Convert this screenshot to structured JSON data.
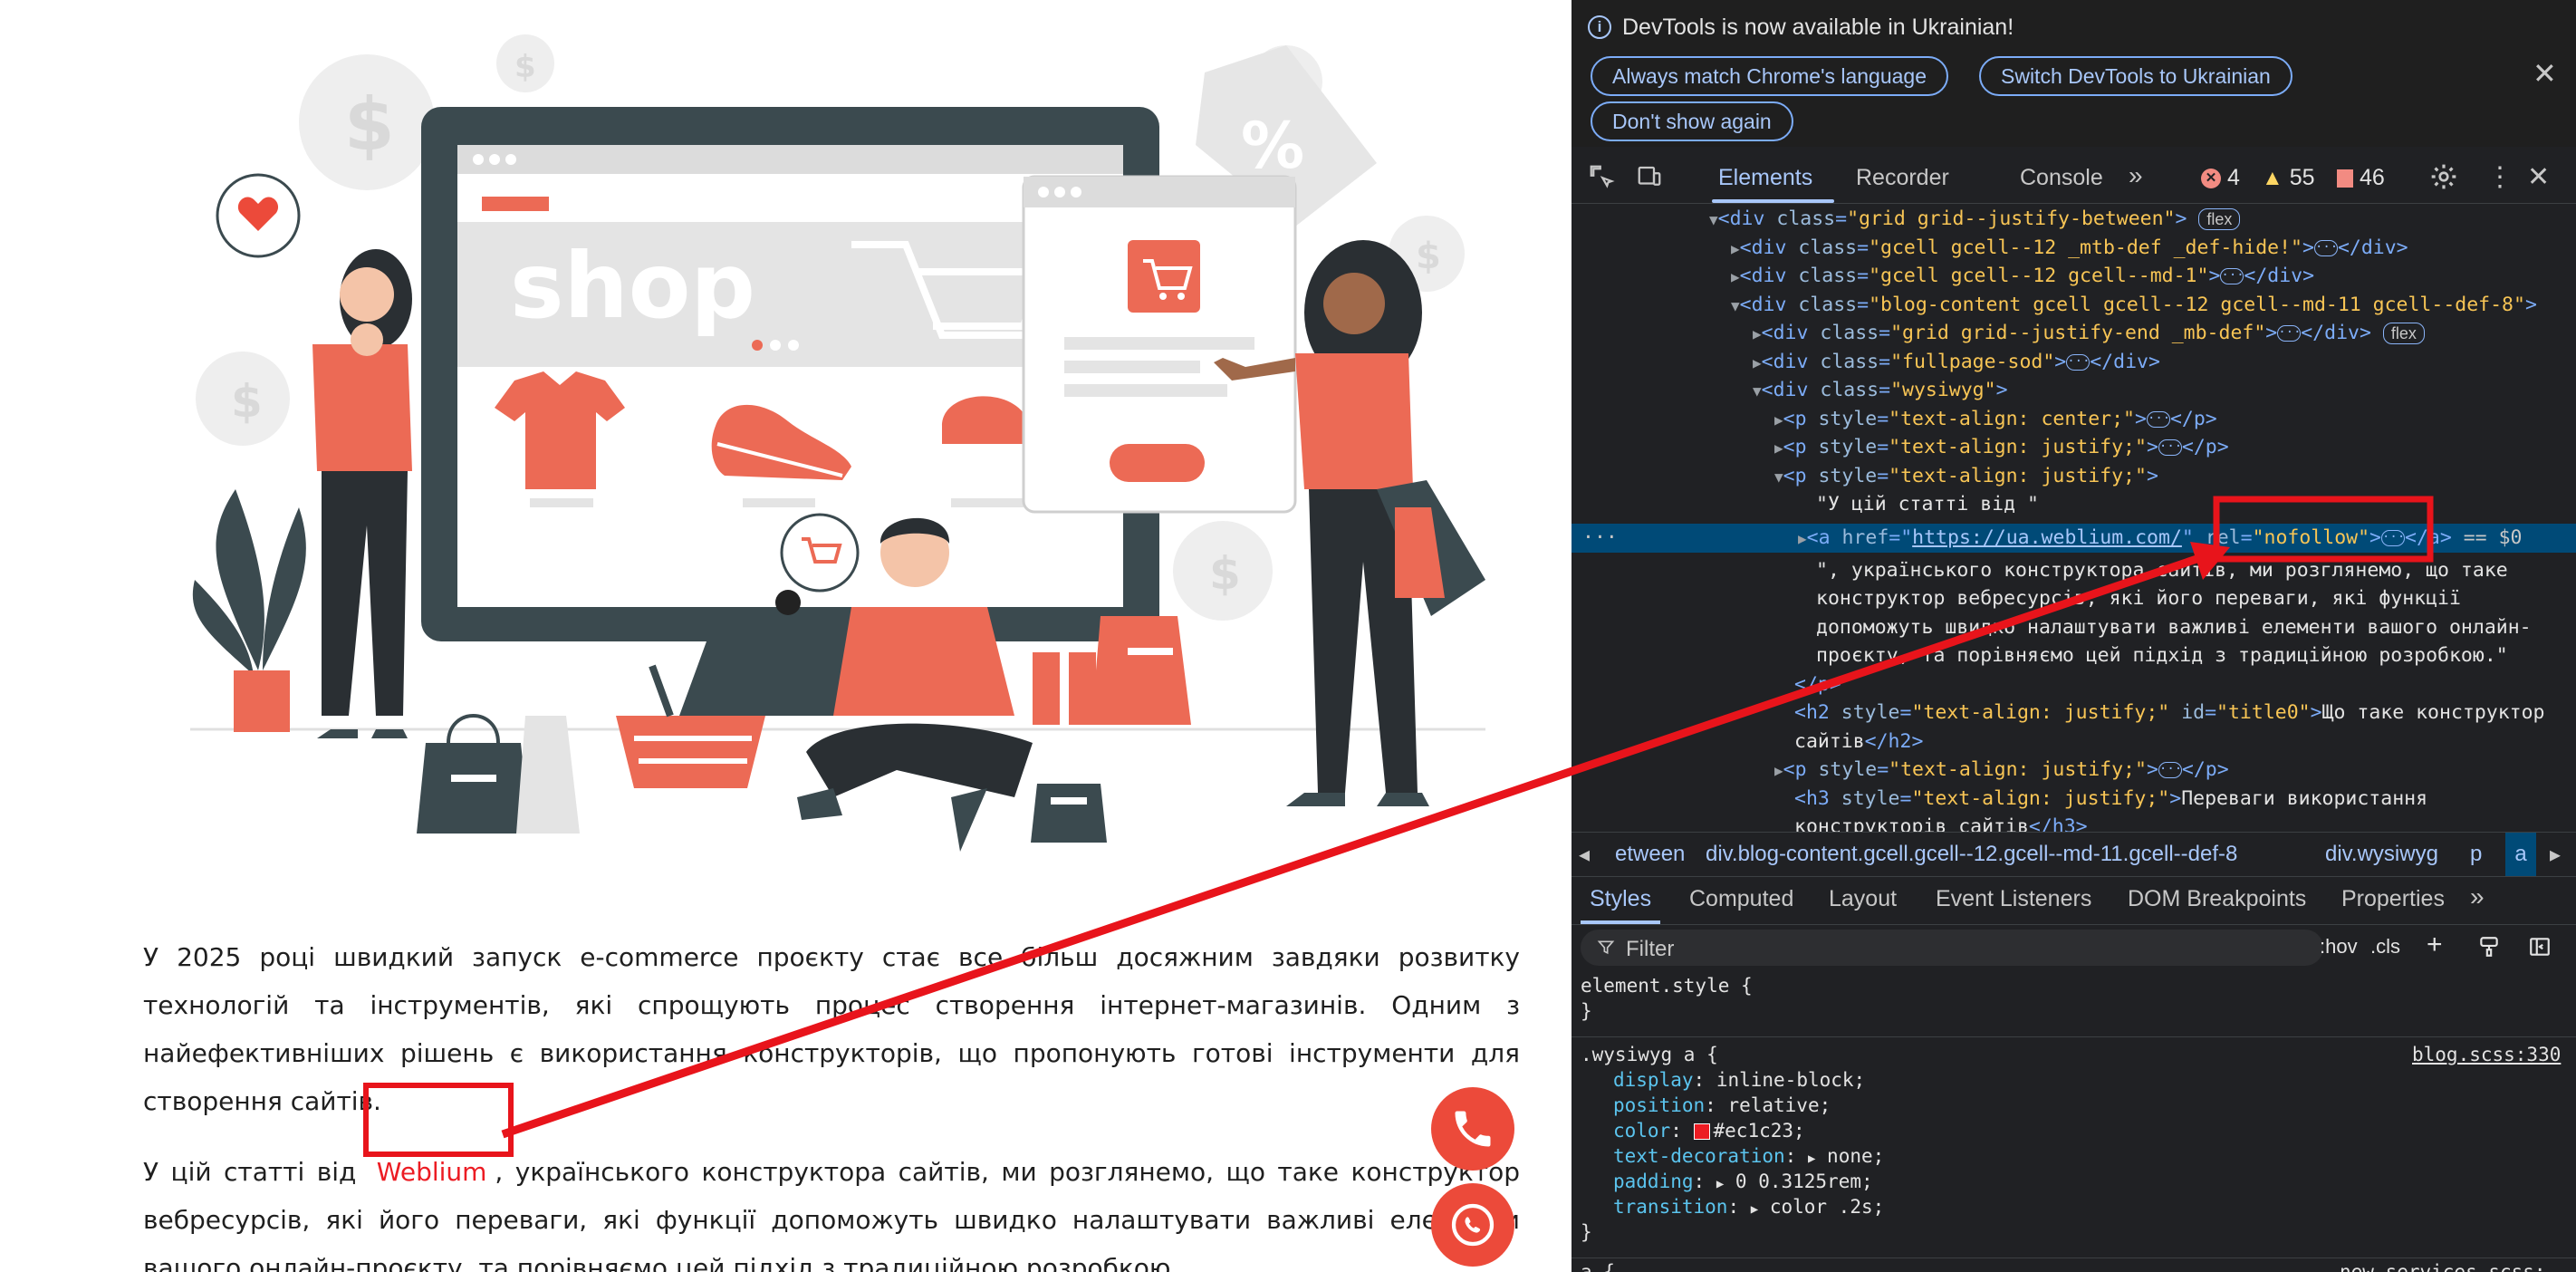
{
  "article": {
    "para1": "У 2025 році швидкий запуск e-commerce проєкту стає все більш досяжним завдяки розвитку технологій та інструментів, які спрощують процес створення інтернет-магазинів. Одним з найефективніших рішень є використання конструкторів, що пропонують готові інструменти для створення сайтів.",
    "para2_pre": "У цій статті від",
    "para2_link": "Weblium",
    "para2_post": ", українського конструктора сайтів, ми розглянемо, що таке конструктор вебресурсів, які його переваги, які функції допоможуть швидко налаштувати важливі елементи вашого онлайн-проєкту, та порівняємо цей підхід з традиційною розробкою."
  },
  "hero": {
    "shop_word": "shop",
    "alt": "shop illustration"
  },
  "contact_buttons": [
    {
      "icon": "phone-icon"
    },
    {
      "icon": "viber-icon"
    }
  ],
  "devtools": {
    "infobar": {
      "message": "DevTools is now available in Ukrainian!",
      "btn_match": "Always match Chrome's language",
      "btn_switch": "Switch DevTools to Ukrainian",
      "btn_dont_show": "Don't show again"
    },
    "tabs": {
      "elements": "Elements",
      "recorder": "Recorder",
      "console": "Console",
      "more": "»"
    },
    "counters": {
      "errors": "4",
      "warnings": "55",
      "issues": "46"
    },
    "dom": {
      "l1_tag": "<div ",
      "l1_attr": "class",
      "l1_val": "\"grid grid--justify-between\"",
      "flex": "flex",
      "l2_val": "\"gcell gcell--12 _mtb-def _def-hide!\"",
      "l3_val": "\"gcell gcell--12 gcell--md-1\"",
      "l4_val": "\"blog-content gcell gcell--12 gcell--md-11 gcell--def-8\"",
      "l5_val": "\"grid grid--justify-end _mb-def\"",
      "l6_val": "\"fullpage-sod\"",
      "l7_val": "\"wysiwyg\"",
      "l8_val": "\"text-align: center;\"",
      "l9_val": "\"text-align: justify;\"",
      "l10_val": "\"text-align: justify;\"",
      "l11_text": "\"У цій статті від \"",
      "l12_href": "https://ua.weblium.com/",
      "l12_rel": "\"nofollow\"",
      "l12_eq": "== $0",
      "l13_text": "\", українського конструктора сайтів, ми розглянемо, що таке",
      "l14_text": "конструктор вебресурсів, які його переваги, які функції",
      "l15_text": "допоможуть швидко налаштувати важливі елементи вашого онлайн-",
      "l16_text": "проєкту, та порівняємо цей підхід з традиційною розробкою.\"",
      "l17": "</p>",
      "l18_val": "\"text-align: justify;\"",
      "l18_id": "\"title0\"",
      "l18_text": "Що таке конструктор",
      "l19_text": "сайтів",
      "l20_val": "\"text-align: justify;\"",
      "l21_val": "\"text-align: justify;\"",
      "l21_text": "Переваги використання",
      "l22_text": "конструкторів сайтів"
    },
    "breadcrumbs": {
      "c1": "etween",
      "c2": "div.blog-content.gcell.gcell--12.gcell--md-11.gcell--def-8",
      "c3": "div.wysiwyg",
      "c4": "p",
      "c5": "a"
    },
    "subtabs": {
      "styles": "Styles",
      "computed": "Computed",
      "layout": "Layout",
      "listeners": "Event Listeners",
      "dom_bp": "DOM Breakpoints",
      "properties": "Properties",
      "more": "»"
    },
    "filter": {
      "placeholder": "Filter",
      "hov": ":hov",
      "cls": ".cls"
    },
    "styles": {
      "element_style": "element.style {",
      "close": "}",
      "rule_selector": ".wysiwyg a {",
      "rule_source": "blog.scss:330",
      "decls": [
        {
          "prop": "display",
          "val": "inline-block;"
        },
        {
          "prop": "position",
          "val": "relative;"
        },
        {
          "prop": "color",
          "val": "#ec1c23;"
        },
        {
          "prop": "text-decoration",
          "val": "none;"
        },
        {
          "prop": "padding",
          "val": "0 0.3125rem;"
        },
        {
          "prop": "transition",
          "val": "color .2s;"
        }
      ],
      "next_selector": "a {",
      "next_source": "new-services.scss:"
    },
    "colors": {
      "accent": "#a8c7fa",
      "selected_row": "#004a77",
      "annotation": "#e8141b",
      "link_red": "#ec1c23"
    }
  }
}
